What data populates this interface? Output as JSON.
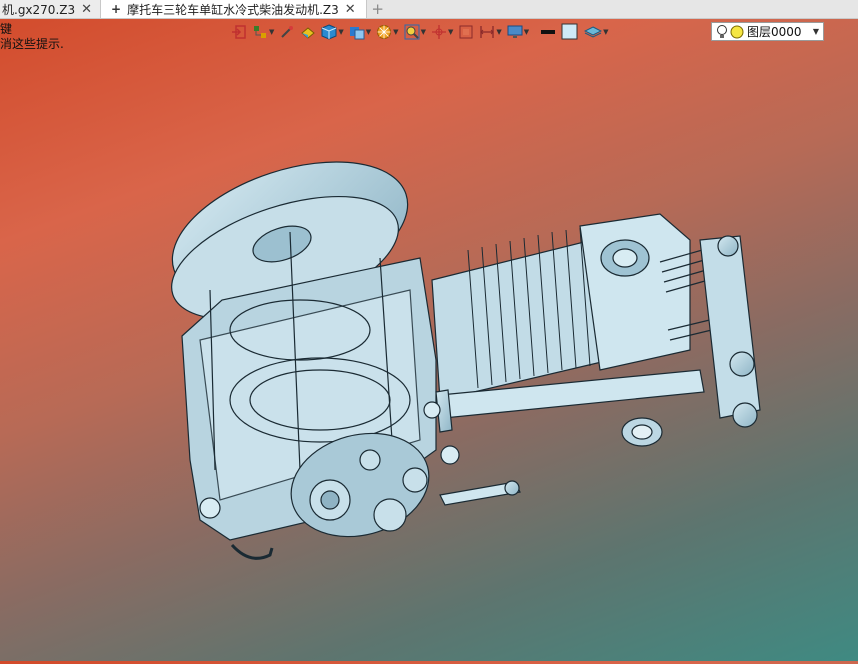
{
  "tabs": [
    {
      "label": "机.gx270.Z3",
      "active": false
    },
    {
      "label": "摩托车三轮车单缸水冷式柴油发动机.Z3",
      "active": true
    }
  ],
  "tab_close_glyph": "✕",
  "tab_plus_glyph": "+",
  "hint_lines": [
    "键",
    "消这些提示."
  ],
  "toolbar": {
    "items": [
      {
        "name": "exit-icon"
      },
      {
        "name": "model-tree-icon"
      },
      {
        "name": "brush-icon"
      },
      {
        "name": "paint-icon"
      },
      {
        "name": "cube-shade-icon"
      },
      {
        "name": "view-style-icon"
      },
      {
        "name": "render-mode-icon"
      },
      {
        "name": "zoom-fit-icon"
      },
      {
        "name": "origin-icon"
      },
      {
        "name": "section-icon"
      },
      {
        "name": "dimension-icon"
      },
      {
        "name": "display-icon"
      },
      {
        "name": "line-style-icon"
      },
      {
        "name": "fill-color-icon"
      },
      {
        "name": "layer-stack-icon"
      }
    ]
  },
  "layer": {
    "value": "图层0000",
    "bulb_color": "#f5e642"
  },
  "colors": {
    "bg_top": "#d24a2a",
    "bg_bottom": "#3f8a82",
    "part_fill": "#b8d6e2",
    "part_edge": "#1a2a33"
  }
}
